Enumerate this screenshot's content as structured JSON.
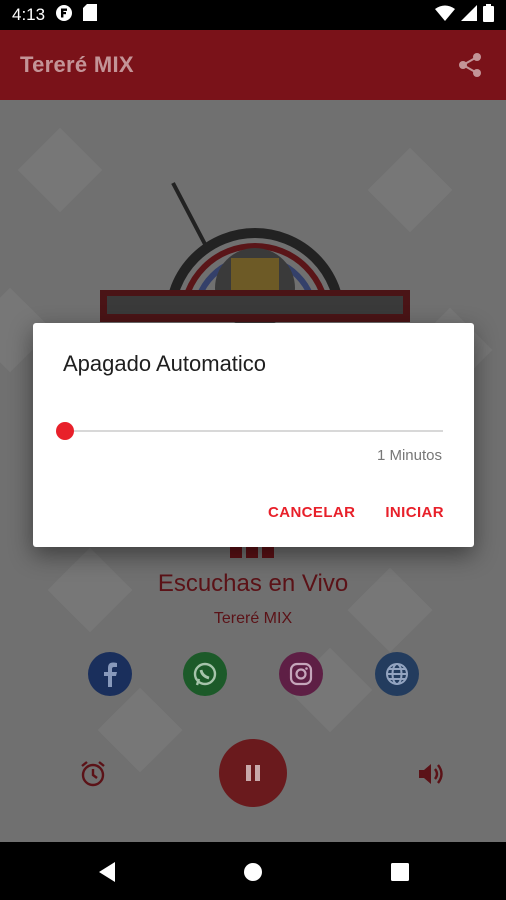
{
  "status_bar": {
    "time": "4:13"
  },
  "app_bar": {
    "title": "Tereré MIX"
  },
  "main": {
    "listeners_label": "Escuchas en Vivo",
    "station_label": "Tereré MIX",
    "social": [
      "facebook-icon",
      "whatsapp-icon",
      "instagram-icon",
      "web-icon"
    ]
  },
  "dialog": {
    "title": "Apagado Automatico",
    "slider_value_label": "1 Minutos",
    "slider_position": 0,
    "cancel_label": "CANCELAR",
    "start_label": "INICIAR"
  },
  "colors": {
    "accent": "#e8202a",
    "app_bar": "#7a1219",
    "dim_text": "#5b1217"
  }
}
